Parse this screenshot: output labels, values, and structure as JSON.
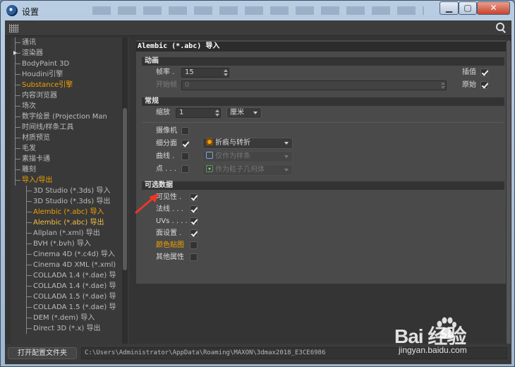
{
  "window": {
    "title": "设置",
    "min": "▁",
    "max": "▢",
    "close": "✕"
  },
  "tree": {
    "items": [
      {
        "label": "通讯",
        "level": 1,
        "state": "normal",
        "collapsed": false
      },
      {
        "label": "渲染器",
        "level": 1,
        "state": "normal",
        "collapsed": true
      },
      {
        "label": "BodyPaint 3D",
        "level": 1,
        "state": "normal",
        "collapsed": false
      },
      {
        "label": "Houdini引擎",
        "level": 1,
        "state": "normal",
        "collapsed": false
      },
      {
        "label": "Substance引擎",
        "level": 1,
        "state": "highlight",
        "collapsed": false
      },
      {
        "label": "内容浏览器",
        "level": 1,
        "state": "normal",
        "collapsed": false
      },
      {
        "label": "场次",
        "level": 1,
        "state": "normal",
        "collapsed": false
      },
      {
        "label": "数字绘景 (Projection Man",
        "level": 1,
        "state": "normal",
        "collapsed": false
      },
      {
        "label": "时间线/样条工具",
        "level": 1,
        "state": "normal",
        "collapsed": false
      },
      {
        "label": "材质预览",
        "level": 1,
        "state": "normal",
        "collapsed": false
      },
      {
        "label": "毛发",
        "level": 1,
        "state": "normal",
        "collapsed": false
      },
      {
        "label": "素描卡通",
        "level": 1,
        "state": "normal",
        "collapsed": false
      },
      {
        "label": "雕刻",
        "level": 1,
        "state": "normal",
        "collapsed": false
      },
      {
        "label": "导入/导出",
        "level": 1,
        "state": "highlight",
        "collapsed": false
      },
      {
        "label": "3D Studio (*.3ds) 导入",
        "level": 2,
        "state": "normal",
        "collapsed": false
      },
      {
        "label": "3D Studio (*.3ds) 导出",
        "level": 2,
        "state": "normal",
        "collapsed": false
      },
      {
        "label": "Alembic (*.abc) 导入",
        "level": 2,
        "state": "highlight",
        "collapsed": false
      },
      {
        "label": "Alembic (*.abc) 导出",
        "level": 2,
        "state": "selected",
        "collapsed": false
      },
      {
        "label": "Allplan (*.xml) 导出",
        "level": 2,
        "state": "normal",
        "collapsed": false
      },
      {
        "label": "BVH (*.bvh) 导入",
        "level": 2,
        "state": "normal",
        "collapsed": false
      },
      {
        "label": "Cinema 4D (*.c4d) 导入",
        "level": 2,
        "state": "normal",
        "collapsed": false
      },
      {
        "label": "Cinema 4D XML (*.xml)",
        "level": 2,
        "state": "normal",
        "collapsed": false
      },
      {
        "label": "COLLADA 1.4 (*.dae) 导",
        "level": 2,
        "state": "normal",
        "collapsed": false
      },
      {
        "label": "COLLADA 1.4 (*.dae) 导",
        "level": 2,
        "state": "normal",
        "collapsed": false
      },
      {
        "label": "COLLADA 1.5 (*.dae) 导",
        "level": 2,
        "state": "normal",
        "collapsed": false
      },
      {
        "label": "COLLADA 1.5 (*.dae) 导",
        "level": 2,
        "state": "normal",
        "collapsed": false
      },
      {
        "label": "DEM (*.dem) 导入",
        "level": 2,
        "state": "normal",
        "collapsed": false
      },
      {
        "label": "Direct 3D (*.x) 导出",
        "level": 2,
        "state": "normal",
        "collapsed": false
      }
    ]
  },
  "panel": {
    "header": "Alembic (*.abc) 导入",
    "animation": {
      "title": "动画",
      "fps_label": "帧率 .",
      "fps_value": "15",
      "start_label": "开始帧",
      "start_value": "0",
      "interp_label": "插值",
      "interp_checked": true,
      "raw_label": "原始",
      "raw_checked": true
    },
    "general": {
      "title": "常规",
      "scale_label": "缩放",
      "scale_value": "1",
      "unit_value": "厘米",
      "camera_label": "摄像机",
      "camera_checked": false,
      "subdiv_label": "细分面",
      "subdiv_checked": true,
      "subdiv_option": "折痕与转折",
      "curves_label": "曲线 .",
      "curves_checked": false,
      "curves_option": "仅作为样条",
      "points_label": "点 . . .",
      "points_checked": false,
      "points_option": "作为粒子几何体"
    },
    "optional": {
      "title": "可选数据",
      "items": [
        {
          "label": "可见性 .",
          "checked": true,
          "orange": false
        },
        {
          "label": "法线 . . .",
          "checked": true,
          "orange": false
        },
        {
          "label": "UVs . . . .",
          "checked": true,
          "orange": false
        },
        {
          "label": "面设置 .",
          "checked": true,
          "orange": false
        },
        {
          "label": "颜色贴图",
          "checked": false,
          "orange": true
        },
        {
          "label": "其他属性",
          "checked": false,
          "orange": false
        }
      ]
    }
  },
  "bottom": {
    "open_button": "打开配置文件夹",
    "path": "C:\\Users\\Administrator\\AppData\\Roaming\\MAXON\\3dmax2018_E3CE6986"
  },
  "watermark": {
    "brand": "Bai  经验",
    "sub": "jingyan.baidu.com"
  },
  "colors": {
    "accent": "#f0a000",
    "background": "#343434",
    "panel": "#4a4a4a",
    "annotation_arrow": "#e83828"
  }
}
